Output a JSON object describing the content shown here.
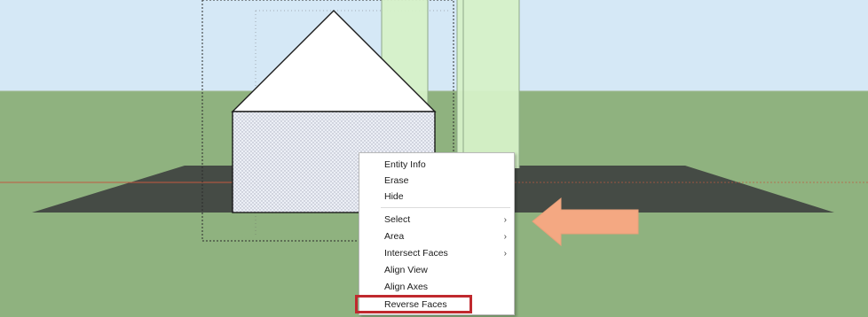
{
  "scene": {
    "sky_color": "#d5e8f6",
    "ground_color": "#8fb27f",
    "shadow_color": "#444a44",
    "wall_color": "#e8ecf4",
    "roof_color": "#ffffff",
    "pillar_color": "#d6f1c8",
    "axis_red": "#c25a40",
    "accent_arrow_color": "#f4a882",
    "highlight_color": "#c0292e"
  },
  "context_menu": {
    "items": [
      {
        "label": "Entity Info",
        "submenu": false
      },
      {
        "label": "Erase",
        "submenu": false
      },
      {
        "label": "Hide",
        "submenu": false
      },
      {
        "label": "Select",
        "submenu": true
      },
      {
        "label": "Area",
        "submenu": true
      },
      {
        "label": "Intersect Faces",
        "submenu": true
      },
      {
        "label": "Align View",
        "submenu": false
      },
      {
        "label": "Align Axes",
        "submenu": false
      },
      {
        "label": "Reverse Faces",
        "submenu": false
      }
    ],
    "submenu_glyph": "›",
    "highlighted_item": "Reverse Faces"
  }
}
